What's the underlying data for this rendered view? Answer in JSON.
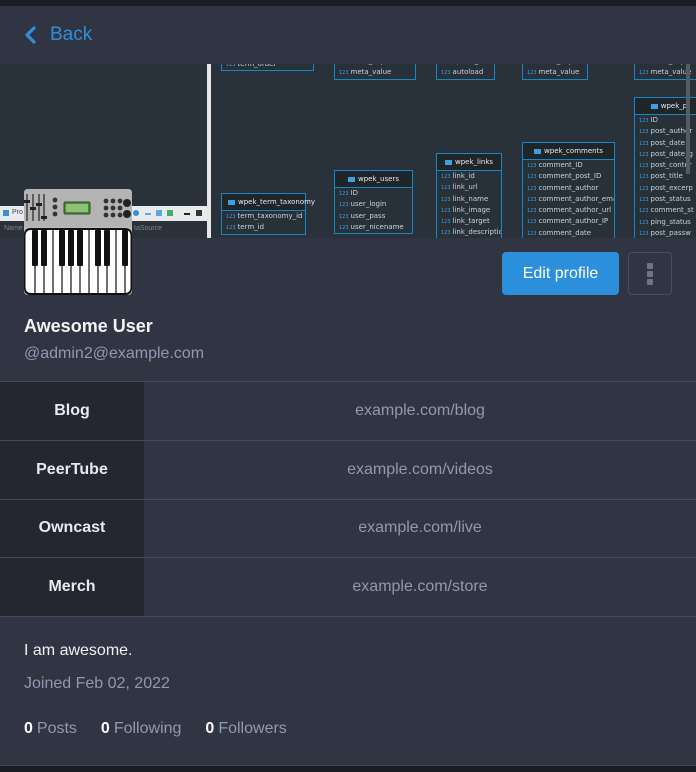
{
  "header": {
    "back_label": "Back"
  },
  "banner": {
    "description": "database schema diagram screenshot",
    "left_pane": {
      "toolbar_label": "Pro",
      "name_column": "Name",
      "datasource_column": "taSource"
    },
    "tables": [
      {
        "title": "",
        "rows": [
          "term_order"
        ]
      },
      {
        "title": "",
        "rows": [
          "meta_key",
          "meta_value"
        ]
      },
      {
        "title": "",
        "rows": [
          "option_value",
          "autoload"
        ]
      },
      {
        "title": "",
        "rows": [
          "meta_key",
          "meta_value"
        ]
      },
      {
        "title": "",
        "rows": [
          "meta_key",
          "meta_value"
        ]
      },
      {
        "title": "wpek_term_taxonomy",
        "rows": [
          "term_taxonomy_id",
          "term_id"
        ]
      },
      {
        "title": "wpek_users",
        "rows": [
          "ID",
          "user_login",
          "user_pass",
          "user_nicename"
        ]
      },
      {
        "title": "wpek_links",
        "rows": [
          "link_id",
          "link_url",
          "link_name",
          "link_image",
          "link_target",
          "link_description"
        ]
      },
      {
        "title": "wpek_comments",
        "rows": [
          "comment_ID",
          "comment_post_ID",
          "comment_author",
          "comment_author_email",
          "comment_author_url",
          "comment_author_IP",
          "comment_date"
        ]
      },
      {
        "title": "wpek_p",
        "rows": [
          "ID",
          "post_author",
          "post_date",
          "post_date_g",
          "post_conter",
          "post_title",
          "post_excerp",
          "post_status",
          "comment_st",
          "ping_status",
          "post_passw"
        ]
      }
    ],
    "row_type_marker": "123"
  },
  "profile": {
    "avatar_alt": "synthesizer keyboard avatar",
    "display_name": "Awesome User",
    "handle": "@admin2@example.com",
    "edit_label": "Edit profile",
    "more_label": "More options",
    "bio": "I am awesome.",
    "joined": "Joined Feb 02, 2022"
  },
  "fields": [
    {
      "name": "Blog",
      "value": "example.com/blog"
    },
    {
      "name": "PeerTube",
      "value": "example.com/videos"
    },
    {
      "name": "Owncast",
      "value": "example.com/live"
    },
    {
      "name": "Merch",
      "value": "example.com/store"
    }
  ],
  "stats": [
    {
      "count": "0",
      "label": "Posts"
    },
    {
      "count": "0",
      "label": "Following"
    },
    {
      "count": "0",
      "label": "Followers"
    }
  ],
  "colors": {
    "accent": "#2b8fdb",
    "background": "#313543",
    "field_name_bg": "#242630",
    "muted_text": "#8d9ab2"
  }
}
